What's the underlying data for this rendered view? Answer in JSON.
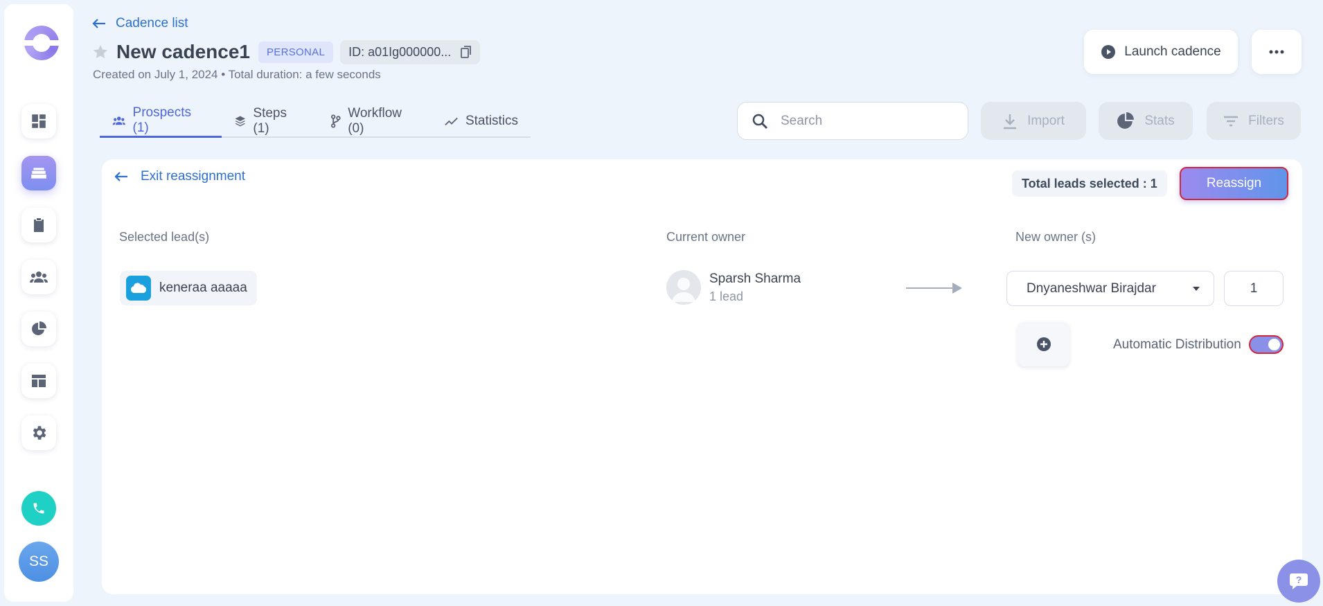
{
  "sidebar": {
    "items": [
      {
        "name": "dashboard",
        "icon": "dashboard-icon"
      },
      {
        "name": "cadences",
        "icon": "stack-icon"
      },
      {
        "name": "tasks",
        "icon": "clipboard-icon"
      },
      {
        "name": "people",
        "icon": "people-icon"
      },
      {
        "name": "analytics",
        "icon": "pie-chart-icon"
      },
      {
        "name": "templates",
        "icon": "layout-icon"
      },
      {
        "name": "settings",
        "icon": "gear-icon"
      }
    ],
    "avatar_initials": "SS"
  },
  "header": {
    "back_label": "Cadence list",
    "title": "New cadence1",
    "badge": "PERSONAL",
    "id_label": "ID: a01Ig000000...",
    "subtitle": "Created on July 1, 2024 • Total duration: a few seconds",
    "launch_label": "Launch cadence"
  },
  "tabs": [
    {
      "label": "Prospects (1)",
      "active": true
    },
    {
      "label": "Steps (1)",
      "active": false
    },
    {
      "label": "Workflow (0)",
      "active": false
    },
    {
      "label": "Statistics",
      "active": false
    }
  ],
  "toolbar": {
    "search_placeholder": "Search",
    "import_label": "Import",
    "stats_label": "Stats",
    "filters_label": "Filters"
  },
  "reassign": {
    "exit_label": "Exit reassignment",
    "total_selected": "Total leads selected : 1",
    "reassign_label": "Reassign",
    "col_selected": "Selected lead(s)",
    "col_current": "Current owner",
    "col_new": "New owner (s)",
    "lead_name": "keneraa aaaaa",
    "owner_name": "Sparsh Sharma",
    "owner_sub": "1 lead",
    "new_owner": "Dnyaneshwar Birajdar",
    "new_owner_count": "1",
    "auto_label": "Automatic Distribution",
    "auto_enabled": true
  },
  "colors": {
    "accent": "#4f66d8",
    "link": "#2d6fcf",
    "reassign_gradient": [
      "#9c8aee",
      "#5f95ea"
    ],
    "phone": "#1fd1c4"
  }
}
